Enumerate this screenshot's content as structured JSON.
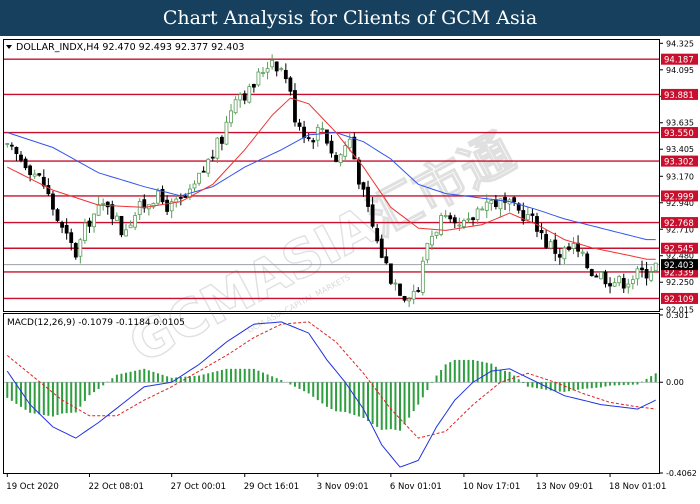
{
  "banner_title": "Chart Analysis for Clients of GCM Asia",
  "watermark_text": "GCMASIA汇市通",
  "watermark_subtext": "GCM ASIA CAPITAL MARKETS",
  "colors": {
    "banner": "#16405e",
    "resistance_line": "#c8102e",
    "ma_blue": "#3355ee",
    "ma_red": "#ee3333",
    "candle_up": "#5a9c5a",
    "candle_down": "#000000",
    "macd_hist": "#2e9e3e",
    "macd_signal": "#dd2222",
    "macd_main": "#2233dd",
    "price_tag": "#c8102e",
    "current_price_tag": "#000000"
  },
  "chart_data": [
    {
      "type": "candlestick",
      "header": "DOLLAR_INDX,H4  92.470 92.493 92.377 92.403",
      "symbol": "DOLLAR_INDX",
      "timeframe": "H4",
      "ohlc": {
        "open": 92.47,
        "high": 92.493,
        "low": 92.377,
        "close": 92.403
      },
      "y_ticks": [
        "94.325",
        "94.095",
        "93.865",
        "93.635",
        "93.405",
        "93.170",
        "92.940",
        "92.710",
        "92.480",
        "92.250",
        "92.015"
      ],
      "ylim": [
        92.0,
        94.345
      ],
      "levels": [
        {
          "label": "94.187",
          "value": 94.187
        },
        {
          "label": "93.881",
          "value": 93.881
        },
        {
          "label": "93.550",
          "value": 93.55
        },
        {
          "label": "93.302",
          "value": 93.302
        },
        {
          "label": "92.999",
          "value": 92.999
        },
        {
          "label": "92.768",
          "value": 92.768
        },
        {
          "label": "92.545",
          "value": 92.545
        },
        {
          "label": "92.339",
          "value": 92.339
        },
        {
          "label": "92.109",
          "value": 92.109
        }
      ],
      "current_price": {
        "label": "92.403",
        "value": 92.403
      },
      "x_labels": [
        {
          "label": "19 Oct 2020",
          "index": 0
        },
        {
          "label": "22 Oct 08:01",
          "index": 18
        },
        {
          "label": "27 Oct 00:01",
          "index": 36
        },
        {
          "label": "29 Oct 16:01",
          "index": 52
        },
        {
          "label": "3 Nov 09:01",
          "index": 68
        },
        {
          "label": "6 Nov 01:01",
          "index": 84
        },
        {
          "label": "10 Nov 17:01",
          "index": 100
        },
        {
          "label": "13 Nov 09:01",
          "index": 116
        },
        {
          "label": "18 Nov 01:01",
          "index": 132
        }
      ],
      "close_path": [
        [
          0,
          93.4
        ],
        [
          4,
          93.3
        ],
        [
          8,
          93.1
        ],
        [
          12,
          92.7
        ],
        [
          15,
          92.5
        ],
        [
          18,
          92.8
        ],
        [
          22,
          92.95
        ],
        [
          25,
          92.7
        ],
        [
          28,
          92.85
        ],
        [
          32,
          93.0
        ],
        [
          36,
          92.9
        ],
        [
          40,
          93.0
        ],
        [
          44,
          93.3
        ],
        [
          47,
          93.5
        ],
        [
          50,
          93.9
        ],
        [
          53,
          93.9
        ],
        [
          56,
          94.1
        ],
        [
          58,
          94.2
        ],
        [
          61,
          94.05
        ],
        [
          63,
          93.7
        ],
        [
          66,
          93.5
        ],
        [
          69,
          93.6
        ],
        [
          72,
          93.3
        ],
        [
          75,
          93.5
        ],
        [
          78,
          93.0
        ],
        [
          81,
          92.6
        ],
        [
          84,
          92.3
        ],
        [
          87,
          92.15
        ],
        [
          90,
          92.2
        ],
        [
          92,
          92.6
        ],
        [
          95,
          92.8
        ],
        [
          98,
          92.7
        ],
        [
          101,
          92.75
        ],
        [
          104,
          92.95
        ],
        [
          107,
          92.95
        ],
        [
          110,
          92.9
        ],
        [
          113,
          92.85
        ],
        [
          116,
          92.75
        ],
        [
          118,
          92.6
        ],
        [
          121,
          92.5
        ],
        [
          124,
          92.55
        ],
        [
          126,
          92.45
        ],
        [
          128,
          92.35
        ],
        [
          131,
          92.3
        ],
        [
          134,
          92.25
        ],
        [
          137,
          92.3
        ],
        [
          140,
          92.35
        ],
        [
          142,
          92.4
        ]
      ],
      "ma_blue_path": [
        [
          0,
          93.55
        ],
        [
          10,
          93.42
        ],
        [
          20,
          93.2
        ],
        [
          30,
          93.08
        ],
        [
          38,
          93.0
        ],
        [
          45,
          93.08
        ],
        [
          52,
          93.25
        ],
        [
          60,
          93.4
        ],
        [
          66,
          93.53
        ],
        [
          72,
          93.55
        ],
        [
          78,
          93.47
        ],
        [
          84,
          93.32
        ],
        [
          90,
          93.1
        ],
        [
          96,
          93.02
        ],
        [
          104,
          92.98
        ],
        [
          110,
          92.95
        ],
        [
          116,
          92.88
        ],
        [
          122,
          92.8
        ],
        [
          128,
          92.74
        ],
        [
          134,
          92.68
        ],
        [
          140,
          92.62
        ]
      ],
      "ma_red_path": [
        [
          0,
          93.25
        ],
        [
          10,
          93.05
        ],
        [
          20,
          92.92
        ],
        [
          30,
          92.9
        ],
        [
          38,
          92.95
        ],
        [
          45,
          93.1
        ],
        [
          52,
          93.4
        ],
        [
          58,
          93.7
        ],
        [
          62,
          93.85
        ],
        [
          66,
          93.8
        ],
        [
          72,
          93.55
        ],
        [
          78,
          93.25
        ],
        [
          84,
          92.9
        ],
        [
          90,
          92.72
        ],
        [
          96,
          92.7
        ],
        [
          104,
          92.75
        ],
        [
          110,
          92.85
        ],
        [
          116,
          92.75
        ],
        [
          122,
          92.62
        ],
        [
          128,
          92.55
        ],
        [
          134,
          92.5
        ],
        [
          140,
          92.45
        ]
      ]
    },
    {
      "type": "line",
      "header": "MACD(12,26,9) -0.1079 -0.1184 0.0105",
      "params": "12,26,9",
      "values": {
        "main": -0.1079,
        "signal": -0.1184,
        "histogram": 0.0105
      },
      "y_ticks": [
        "0.301",
        "0.00",
        "-0.4062"
      ],
      "ylim": [
        -0.4062,
        0.301
      ],
      "main_path": [
        [
          0,
          0.05
        ],
        [
          5,
          -0.1
        ],
        [
          10,
          -0.2
        ],
        [
          15,
          -0.25
        ],
        [
          20,
          -0.18
        ],
        [
          25,
          -0.1
        ],
        [
          30,
          -0.02
        ],
        [
          36,
          0.0
        ],
        [
          42,
          0.08
        ],
        [
          48,
          0.18
        ],
        [
          54,
          0.26
        ],
        [
          60,
          0.27
        ],
        [
          66,
          0.22
        ],
        [
          70,
          0.1
        ],
        [
          74,
          0.0
        ],
        [
          78,
          -0.12
        ],
        [
          82,
          -0.28
        ],
        [
          86,
          -0.38
        ],
        [
          90,
          -0.35
        ],
        [
          94,
          -0.2
        ],
        [
          98,
          -0.08
        ],
        [
          102,
          0.0
        ],
        [
          106,
          0.05
        ],
        [
          110,
          0.06
        ],
        [
          114,
          0.02
        ],
        [
          118,
          -0.02
        ],
        [
          122,
          -0.06
        ],
        [
          126,
          -0.08
        ],
        [
          130,
          -0.1
        ],
        [
          134,
          -0.11
        ],
        [
          138,
          -0.12
        ],
        [
          142,
          -0.08
        ]
      ],
      "signal_path": [
        [
          0,
          0.12
        ],
        [
          6,
          0.02
        ],
        [
          12,
          -0.08
        ],
        [
          18,
          -0.15
        ],
        [
          24,
          -0.15
        ],
        [
          30,
          -0.08
        ],
        [
          36,
          -0.02
        ],
        [
          42,
          0.05
        ],
        [
          48,
          0.12
        ],
        [
          54,
          0.2
        ],
        [
          60,
          0.26
        ],
        [
          66,
          0.27
        ],
        [
          72,
          0.18
        ],
        [
          78,
          0.04
        ],
        [
          84,
          -0.12
        ],
        [
          90,
          -0.25
        ],
        [
          96,
          -0.22
        ],
        [
          102,
          -0.1
        ],
        [
          108,
          0.0
        ],
        [
          114,
          0.04
        ],
        [
          120,
          0.0
        ],
        [
          126,
          -0.05
        ],
        [
          132,
          -0.09
        ],
        [
          138,
          -0.11
        ],
        [
          142,
          -0.12
        ]
      ]
    }
  ]
}
